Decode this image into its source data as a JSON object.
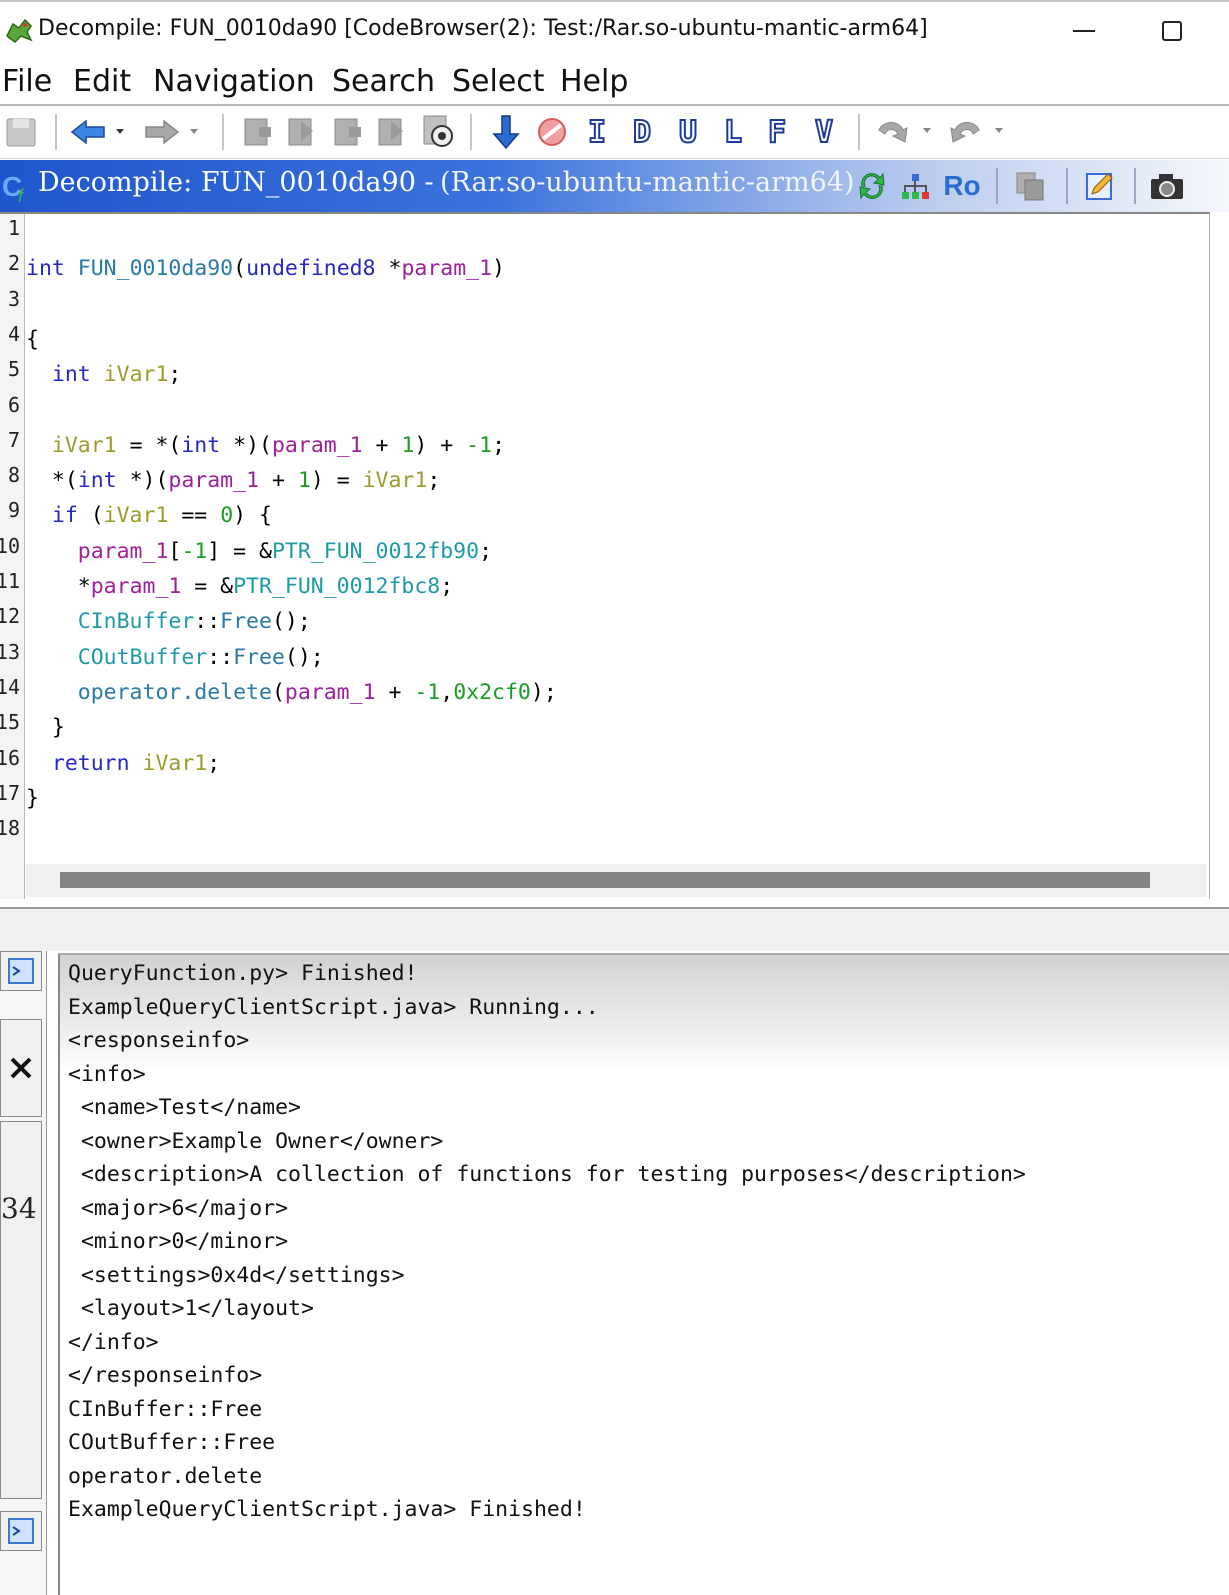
{
  "window": {
    "title": "Decompile: FUN_0010da90 [CodeBrowser(2): Test:/Rar.so-ubuntu-mantic-arm64]"
  },
  "menu": [
    "File",
    "Edit",
    "Navigation",
    "Search",
    "Select",
    "Help"
  ],
  "toolbar": {
    "letter_buttons": [
      "I",
      "D",
      "U",
      "L",
      "F",
      "V"
    ],
    "ro_label": "Ro"
  },
  "decompiler": {
    "header_title": "Decompile: FUN_0010da90 -",
    "header_program": "(Rar.so-ubuntu-mantic-arm64)",
    "line_numbers": [
      "1",
      "2",
      "3",
      "4",
      "5",
      "6",
      "7",
      "8",
      "9",
      "10",
      "11",
      "12",
      "13",
      "14",
      "15",
      "16",
      "17",
      "18"
    ],
    "code": [
      [],
      [
        [
          "kw",
          "int"
        ],
        [
          "pn",
          " "
        ],
        [
          "fn",
          "FUN_0010da90"
        ],
        [
          "pn",
          "("
        ],
        [
          "kw",
          "undefined8"
        ],
        [
          "pn",
          " *"
        ],
        [
          "prm",
          "param_1"
        ],
        [
          "pn",
          ")"
        ]
      ],
      [],
      [
        [
          "pn",
          "{"
        ]
      ],
      [
        [
          "pn",
          "  "
        ],
        [
          "kw",
          "int"
        ],
        [
          "pn",
          " "
        ],
        [
          "var",
          "iVar1"
        ],
        [
          "pn",
          ";"
        ]
      ],
      [],
      [
        [
          "pn",
          "  "
        ],
        [
          "var",
          "iVar1"
        ],
        [
          "pn",
          " = *("
        ],
        [
          "kw",
          "int"
        ],
        [
          "pn",
          " *)("
        ],
        [
          "prm",
          "param_1"
        ],
        [
          "pn",
          " + "
        ],
        [
          "num",
          "1"
        ],
        [
          "pn",
          ") + "
        ],
        [
          "num",
          "-1"
        ],
        [
          "pn",
          ";"
        ]
      ],
      [
        [
          "pn",
          "  *("
        ],
        [
          "kw",
          "int"
        ],
        [
          "pn",
          " *)("
        ],
        [
          "prm",
          "param_1"
        ],
        [
          "pn",
          " + "
        ],
        [
          "num",
          "1"
        ],
        [
          "pn",
          ") = "
        ],
        [
          "var",
          "iVar1"
        ],
        [
          "pn",
          ";"
        ]
      ],
      [
        [
          "pn",
          "  "
        ],
        [
          "kw",
          "if"
        ],
        [
          "pn",
          " ("
        ],
        [
          "var",
          "iVar1"
        ],
        [
          "pn",
          " == "
        ],
        [
          "num",
          "0"
        ],
        [
          "pn",
          ") {"
        ]
      ],
      [
        [
          "pn",
          "    "
        ],
        [
          "prm",
          "param_1"
        ],
        [
          "pn",
          "["
        ],
        [
          "num",
          "-1"
        ],
        [
          "pn",
          "] = &"
        ],
        [
          "glb",
          "PTR_FUN_0012fb90"
        ],
        [
          "pn",
          ";"
        ]
      ],
      [
        [
          "pn",
          "    *"
        ],
        [
          "prm",
          "param_1"
        ],
        [
          "pn",
          " = &"
        ],
        [
          "glb",
          "PTR_FUN_0012fbc8"
        ],
        [
          "pn",
          ";"
        ]
      ],
      [
        [
          "pn",
          "    "
        ],
        [
          "glb",
          "CInBuffer"
        ],
        [
          "pn",
          "::"
        ],
        [
          "fn",
          "Free"
        ],
        [
          "pn",
          "();"
        ]
      ],
      [
        [
          "pn",
          "    "
        ],
        [
          "glb",
          "COutBuffer"
        ],
        [
          "pn",
          "::"
        ],
        [
          "fn",
          "Free"
        ],
        [
          "pn",
          "();"
        ]
      ],
      [
        [
          "pn",
          "    "
        ],
        [
          "fn",
          "operator.delete"
        ],
        [
          "pn",
          "("
        ],
        [
          "prm",
          "param_1"
        ],
        [
          "pn",
          " + "
        ],
        [
          "num",
          "-1"
        ],
        [
          "pn",
          ","
        ],
        [
          "num",
          "0x2cf0"
        ],
        [
          "pn",
          ");"
        ]
      ],
      [
        [
          "pn",
          "  }"
        ]
      ],
      [
        [
          "pn",
          "  "
        ],
        [
          "kw",
          "return"
        ],
        [
          "pn",
          " "
        ],
        [
          "var",
          "iVar1"
        ],
        [
          "pn",
          ";"
        ]
      ],
      [
        [
          "pn",
          "}"
        ]
      ],
      []
    ]
  },
  "console": {
    "lines": [
      "QueryFunction.py> Finished!",
      "ExampleQueryClientScript.java> Running...",
      "<responseinfo>",
      "<info>",
      " <name>Test</name>",
      " <owner>Example Owner</owner>",
      " <description>A collection of functions for testing purposes</description>",
      " <major>6</major>",
      " <minor>0</minor>",
      " <settings>0x4d</settings>",
      " <layout>1</layout>",
      "</info>",
      "</responseinfo>",
      "CInBuffer::Free",
      "COutBuffer::Free",
      "operator.delete",
      "ExampleQueryClientScript.java> Finished!"
    ],
    "side_label": "34"
  }
}
